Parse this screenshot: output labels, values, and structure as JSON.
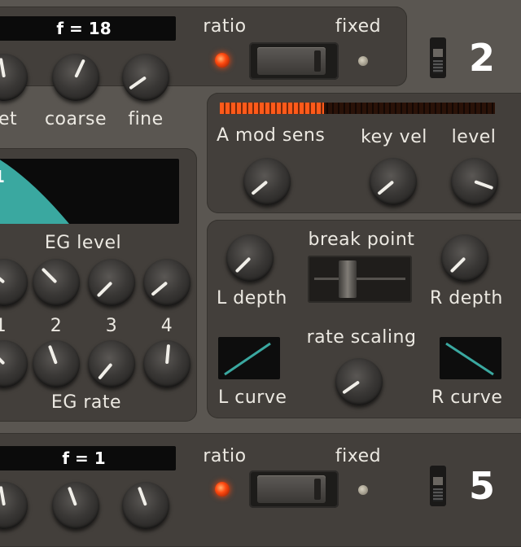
{
  "op_top": {
    "freq_display": "f = 18",
    "ratio_label": "ratio",
    "fixed_label": "fixed",
    "op_number": "2",
    "knob_labels": [
      "et",
      "coarse",
      "fine"
    ]
  },
  "modulation": {
    "labels": [
      "A mod sens",
      "key vel",
      "level"
    ],
    "meter_fraction": 0.38,
    "meter_color": "#ff5a1a"
  },
  "eg": {
    "graph_label": "1",
    "level_label": "EG level",
    "rate_label": "EG rate",
    "stage_numbers": [
      "1",
      "2",
      "3",
      "4"
    ],
    "fill_color": "#3aa8a0"
  },
  "scaling": {
    "l_depth": "L depth",
    "break_point": "break point",
    "r_depth": "R depth",
    "rate_scaling": "rate scaling",
    "l_curve": "L curve",
    "r_curve": "R curve",
    "curve_color": "#3aa8a0"
  },
  "op_bottom": {
    "freq_display": "f = 1",
    "ratio_label": "ratio",
    "fixed_label": "fixed",
    "op_number": "5"
  }
}
